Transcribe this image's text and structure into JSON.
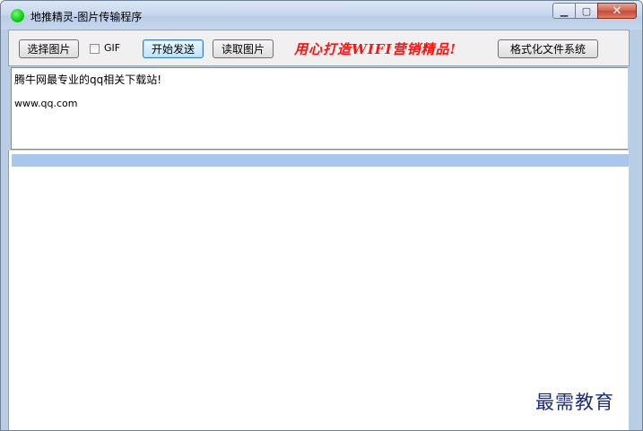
{
  "window": {
    "title": "地推精灵-图片传输程序",
    "controls": {
      "minimize": "▁",
      "maximize": "▢",
      "close": "✕"
    }
  },
  "toolbar": {
    "select_image_label": "选择图片",
    "gif_label": "GIF",
    "gif_checked": false,
    "start_send_label": "开始发送",
    "read_image_label": "读取图片",
    "slogan": "用心打造WIFI营销精品!",
    "format_fs_label": "格式化文件系统"
  },
  "log": {
    "line1": "腾牛网最专业的qq相关下载站!",
    "line2": "www.qq.com"
  },
  "list": {
    "selected_row_color": "#a9c7ec"
  },
  "watermark": "最需教育",
  "colors": {
    "slogan": "#ff1010",
    "app_icon": "#14c814",
    "close_button": "#c44a34"
  }
}
